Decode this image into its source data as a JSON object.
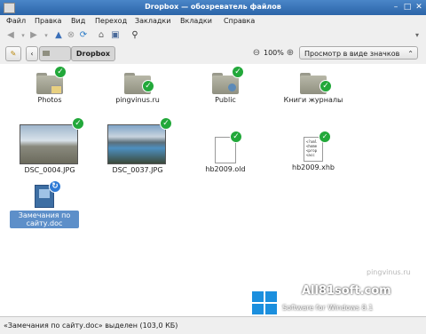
{
  "window": {
    "title": "Dropbox — обозреватель файлов"
  },
  "menu": [
    "Файл",
    "Правка",
    "Вид",
    "Переход",
    "Закладки",
    "Вкладки",
    "Справка"
  ],
  "toolbar": {
    "icons": [
      "back-icon",
      "forward-icon",
      "up-icon",
      "stop-icon",
      "reload-icon",
      "home-icon",
      "computer-icon",
      "search-icon"
    ]
  },
  "location": {
    "current": "Dropbox",
    "zoom": "100%",
    "view_mode": "Просмотр в виде значков"
  },
  "items": [
    {
      "name": "Photos",
      "kind": "folder",
      "emblem": "sync-ok"
    },
    {
      "name": "pingvinus.ru",
      "kind": "folder",
      "emblem": "sync-ok"
    },
    {
      "name": "Public",
      "kind": "folder",
      "emblem": "sync-ok"
    },
    {
      "name": "Книги журналы",
      "kind": "folder",
      "emblem": "sync-ok"
    },
    {
      "name": "DSC_0004.JPG",
      "kind": "image",
      "emblem": "sync-ok"
    },
    {
      "name": "DSC_0037.JPG",
      "kind": "image",
      "emblem": "sync-ok"
    },
    {
      "name": "hb2009.old",
      "kind": "file",
      "emblem": "sync-ok"
    },
    {
      "name": "hb2009.xhb",
      "kind": "file",
      "emblem": "sync-ok"
    },
    {
      "name": "Замечания по сайту.doc",
      "kind": "document",
      "emblem": "syncing",
      "selected": true
    }
  ],
  "xhb_preview": [
    "<?xml",
    "<home",
    "<prop",
    "<acc"
  ],
  "status": "«Замечания по сайту.doc» выделен (103,0 КБ)",
  "watermark": {
    "site": "All81soft.com",
    "tagline": "Software for Windows 8.1",
    "pingvinus": "pingvinus.ru"
  }
}
